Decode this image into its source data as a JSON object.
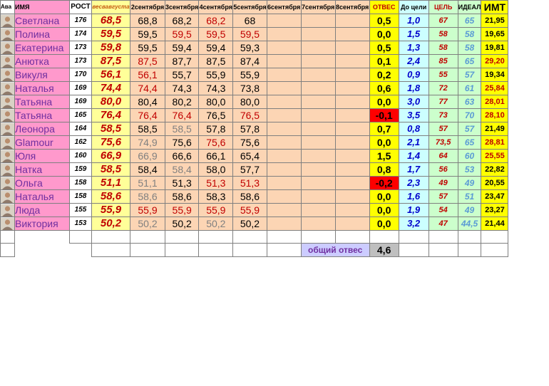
{
  "headers": {
    "ava": "Ава",
    "name": "ИМЯ",
    "rost": "РОСТ",
    "w0": "весвавгуста",
    "days": [
      "2сентября",
      "3сентября",
      "4сентября",
      "5сентября",
      "6сентября",
      "7сентября",
      "8сентября"
    ],
    "otves": "ОТВЕС",
    "do_celi": "До цели",
    "cel": "ЦЕЛЬ",
    "ideal": "ИДЕАЛ",
    "imt": "ИМТ"
  },
  "colors": {
    "red_value": "#c00000",
    "gray_value": "#808080",
    "black_value": "#000000"
  },
  "rows": [
    {
      "name": "Светлана",
      "rost": "176",
      "w0": "68,5",
      "days": [
        {
          "v": "68,8",
          "c": "k"
        },
        {
          "v": "68,2",
          "c": "k"
        },
        {
          "v": "68,2",
          "c": "r"
        },
        {
          "v": "68",
          "c": "k"
        },
        {
          "v": "",
          "c": "k"
        },
        {
          "v": "",
          "c": "k"
        },
        {
          "v": "",
          "c": "k"
        }
      ],
      "otves": "0,5",
      "neg": false,
      "do": "1,0",
      "cel": "67",
      "ideal": "65",
      "imt": "21,95",
      "imt_red": false
    },
    {
      "name": "Полина",
      "rost": "174",
      "w0": "59,5",
      "days": [
        {
          "v": "59,5",
          "c": "k"
        },
        {
          "v": "59,5",
          "c": "r"
        },
        {
          "v": "59,5",
          "c": "r"
        },
        {
          "v": "59,5",
          "c": "r"
        },
        {
          "v": "",
          "c": "k"
        },
        {
          "v": "",
          "c": "k"
        },
        {
          "v": "",
          "c": "k"
        }
      ],
      "otves": "0,0",
      "neg": false,
      "do": "1,5",
      "cel": "58",
      "ideal": "58",
      "imt": "19,65",
      "imt_red": false
    },
    {
      "name": "Екатерина",
      "rost": "173",
      "w0": "59,8",
      "days": [
        {
          "v": "59,5",
          "c": "k"
        },
        {
          "v": "59,4",
          "c": "k"
        },
        {
          "v": "59,4",
          "c": "k"
        },
        {
          "v": "59,3",
          "c": "k"
        },
        {
          "v": "",
          "c": "k"
        },
        {
          "v": "",
          "c": "k"
        },
        {
          "v": "",
          "c": "k"
        }
      ],
      "otves": "0,5",
      "neg": false,
      "do": "1,3",
      "cel": "58",
      "ideal": "58",
      "imt": "19,81",
      "imt_red": false
    },
    {
      "name": "Анютка",
      "rost": "173",
      "w0": "87,5",
      "days": [
        {
          "v": "87,5",
          "c": "r"
        },
        {
          "v": "87,7",
          "c": "k"
        },
        {
          "v": "87,5",
          "c": "k"
        },
        {
          "v": "87,4",
          "c": "k"
        },
        {
          "v": "",
          "c": "k"
        },
        {
          "v": "",
          "c": "k"
        },
        {
          "v": "",
          "c": "k"
        }
      ],
      "otves": "0,1",
      "neg": false,
      "do": "2,4",
      "cel": "85",
      "ideal": "65",
      "imt": "29,20",
      "imt_red": true
    },
    {
      "name": "Викуля",
      "rost": "170",
      "w0": "56,1",
      "days": [
        {
          "v": "56,1",
          "c": "r"
        },
        {
          "v": "55,7",
          "c": "k"
        },
        {
          "v": "55,9",
          "c": "k"
        },
        {
          "v": "55,9",
          "c": "k"
        },
        {
          "v": "",
          "c": "k"
        },
        {
          "v": "",
          "c": "k"
        },
        {
          "v": "",
          "c": "k"
        }
      ],
      "otves": "0,2",
      "neg": false,
      "do": "0,9",
      "cel": "55",
      "ideal": "57",
      "imt": "19,34",
      "imt_red": false
    },
    {
      "name": "Наталья",
      "rost": "169",
      "w0": "74,4",
      "days": [
        {
          "v": "74,4",
          "c": "r"
        },
        {
          "v": "74,3",
          "c": "k"
        },
        {
          "v": "74,3",
          "c": "k"
        },
        {
          "v": "73,8",
          "c": "k"
        },
        {
          "v": "",
          "c": "k"
        },
        {
          "v": "",
          "c": "k"
        },
        {
          "v": "",
          "c": "k"
        }
      ],
      "otves": "0,6",
      "neg": false,
      "do": "1,8",
      "cel": "72",
      "ideal": "61",
      "imt": "25,84",
      "imt_red": true
    },
    {
      "name": "Татьяна",
      "rost": "169",
      "w0": "80,0",
      "days": [
        {
          "v": "80,4",
          "c": "k"
        },
        {
          "v": "80,2",
          "c": "k"
        },
        {
          "v": "80,0",
          "c": "k"
        },
        {
          "v": "80,0",
          "c": "k"
        },
        {
          "v": "",
          "c": "k"
        },
        {
          "v": "",
          "c": "k"
        },
        {
          "v": "",
          "c": "k"
        }
      ],
      "otves": "0,0",
      "neg": false,
      "do": "3,0",
      "cel": "77",
      "ideal": "63",
      "imt": "28,01",
      "imt_red": true
    },
    {
      "name": "Татьяна",
      "rost": "165",
      "w0": "76,4",
      "days": [
        {
          "v": "76,4",
          "c": "r"
        },
        {
          "v": "76,4",
          "c": "r"
        },
        {
          "v": "76,5",
          "c": "k"
        },
        {
          "v": "76,5",
          "c": "r"
        },
        {
          "v": "",
          "c": "k"
        },
        {
          "v": "",
          "c": "k"
        },
        {
          "v": "",
          "c": "k"
        }
      ],
      "otves": "-0,1",
      "neg": true,
      "do": "3,5",
      "cel": "73",
      "ideal": "70",
      "imt": "28,10",
      "imt_red": true
    },
    {
      "name": "Леонора",
      "rost": "164",
      "w0": "58,5",
      "days": [
        {
          "v": "58,5",
          "c": "k"
        },
        {
          "v": "58,5",
          "c": "g"
        },
        {
          "v": "57,8",
          "c": "k"
        },
        {
          "v": "57,8",
          "c": "k"
        },
        {
          "v": "",
          "c": "k"
        },
        {
          "v": "",
          "c": "k"
        },
        {
          "v": "",
          "c": "k"
        }
      ],
      "otves": "0,7",
      "neg": false,
      "do": "0,8",
      "cel": "57",
      "ideal": "57",
      "imt": "21,49",
      "imt_red": false
    },
    {
      "name": "Glamour",
      "rost": "162",
      "w0": "75,6",
      "days": [
        {
          "v": "74,9",
          "c": "g"
        },
        {
          "v": "75,6",
          "c": "k"
        },
        {
          "v": "75,6",
          "c": "r"
        },
        {
          "v": "75,6",
          "c": "k"
        },
        {
          "v": "",
          "c": "k"
        },
        {
          "v": "",
          "c": "k"
        },
        {
          "v": "",
          "c": "k"
        }
      ],
      "otves": "0,0",
      "neg": false,
      "do": "2,1",
      "cel": "73,5",
      "ideal": "65",
      "imt": "28,81",
      "imt_red": true
    },
    {
      "name": "Юля",
      "rost": "160",
      "w0": "66,9",
      "days": [
        {
          "v": "66,9",
          "c": "g"
        },
        {
          "v": "66,6",
          "c": "k"
        },
        {
          "v": "66,1",
          "c": "k"
        },
        {
          "v": "65,4",
          "c": "k"
        },
        {
          "v": "",
          "c": "k"
        },
        {
          "v": "",
          "c": "k"
        },
        {
          "v": "",
          "c": "k"
        }
      ],
      "otves": "1,5",
      "neg": false,
      "do": "1,4",
      "cel": "64",
      "ideal": "60",
      "imt": "25,55",
      "imt_red": true
    },
    {
      "name": "Натка",
      "rost": "159",
      "w0": "58,5",
      "days": [
        {
          "v": "58,4",
          "c": "k"
        },
        {
          "v": "58,4",
          "c": "g"
        },
        {
          "v": "58,0",
          "c": "k"
        },
        {
          "v": "57,7",
          "c": "k"
        },
        {
          "v": "",
          "c": "k"
        },
        {
          "v": "",
          "c": "k"
        },
        {
          "v": "",
          "c": "k"
        }
      ],
      "otves": "0,8",
      "neg": false,
      "do": "1,7",
      "cel": "56",
      "ideal": "53",
      "imt": "22,82",
      "imt_red": false
    },
    {
      "name": "Ольга",
      "rost": "158",
      "w0": "51,1",
      "days": [
        {
          "v": "51,1",
          "c": "g"
        },
        {
          "v": "51,3",
          "c": "k"
        },
        {
          "v": "51,3",
          "c": "r"
        },
        {
          "v": "51,3",
          "c": "r"
        },
        {
          "v": "",
          "c": "k"
        },
        {
          "v": "",
          "c": "k"
        },
        {
          "v": "",
          "c": "k"
        }
      ],
      "otves": "-0,2",
      "neg": true,
      "do": "2,3",
      "cel": "49",
      "ideal": "49",
      "imt": "20,55",
      "imt_red": false
    },
    {
      "name": "Наталья",
      "rost": "158",
      "w0": "58,6",
      "days": [
        {
          "v": "58,6",
          "c": "g"
        },
        {
          "v": "58,6",
          "c": "k"
        },
        {
          "v": "58,3",
          "c": "k"
        },
        {
          "v": "58,6",
          "c": "k"
        },
        {
          "v": "",
          "c": "k"
        },
        {
          "v": "",
          "c": "k"
        },
        {
          "v": "",
          "c": "k"
        }
      ],
      "otves": "0,0",
      "neg": false,
      "do": "1,6",
      "cel": "57",
      "ideal": "51",
      "imt": "23,47",
      "imt_red": false
    },
    {
      "name": "Люда",
      "rost": "155",
      "w0": "55,9",
      "days": [
        {
          "v": "55,9",
          "c": "r"
        },
        {
          "v": "55,9",
          "c": "r"
        },
        {
          "v": "55,9",
          "c": "r"
        },
        {
          "v": "55,9",
          "c": "r"
        },
        {
          "v": "",
          "c": "k"
        },
        {
          "v": "",
          "c": "k"
        },
        {
          "v": "",
          "c": "k"
        }
      ],
      "otves": "0,0",
      "neg": false,
      "do": "1,9",
      "cel": "54",
      "ideal": "49",
      "imt": "23,27",
      "imt_red": false
    },
    {
      "name": "Виктория",
      "rost": "153",
      "w0": "50,2",
      "days": [
        {
          "v": "50,2",
          "c": "g"
        },
        {
          "v": "50,2",
          "c": "k"
        },
        {
          "v": "50,2",
          "c": "g"
        },
        {
          "v": "50,2",
          "c": "k"
        },
        {
          "v": "",
          "c": "k"
        },
        {
          "v": "",
          "c": "k"
        },
        {
          "v": "",
          "c": "k"
        }
      ],
      "otves": "0,0",
      "neg": false,
      "do": "3,2",
      "cel": "47",
      "ideal": "44,5",
      "imt": "21,44",
      "imt_red": false
    }
  ],
  "total": {
    "label": "общий отвес",
    "value": "4,6"
  }
}
